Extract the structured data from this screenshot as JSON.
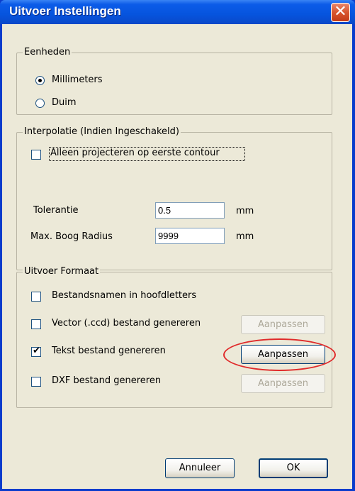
{
  "window": {
    "title": "Uitvoer Instellingen",
    "close_glyph": "✕"
  },
  "units": {
    "legend": "Eenheden",
    "options": [
      {
        "label": "Millimeters",
        "checked": true
      },
      {
        "label": "Duim",
        "checked": false
      }
    ]
  },
  "interpolation": {
    "legend": "Interpolatie (Indien Ingeschakeld)",
    "project_first_contour": {
      "label": "Alleen projecteren op eerste contour",
      "checked": false
    },
    "tolerance": {
      "label": "Tolerantie",
      "value": "0.5",
      "unit": "mm"
    },
    "max_arc_radius": {
      "label": "Max. Boog Radius",
      "value": "9999",
      "unit": "mm"
    }
  },
  "output_format": {
    "legend": "Uitvoer Formaat",
    "uppercase_filenames": {
      "label": "Bestandsnamen in hoofdletters",
      "checked": false
    },
    "vector_file": {
      "label": "Vector (.ccd) bestand genereren",
      "checked": false,
      "button": "Aanpassen",
      "enabled": false
    },
    "text_file": {
      "label": "Tekst bestand genereren",
      "checked": true,
      "button": "Aanpassen",
      "enabled": true
    },
    "dxf_file": {
      "label": "DXF bestand genereren",
      "checked": false,
      "button": "Aanpassen",
      "enabled": false
    }
  },
  "footer": {
    "cancel": "Annuleer",
    "ok": "OK"
  },
  "colors": {
    "titlebar": "#0654de",
    "highlight": "#e02a2a",
    "dialog_bg": "#ece9d8"
  }
}
